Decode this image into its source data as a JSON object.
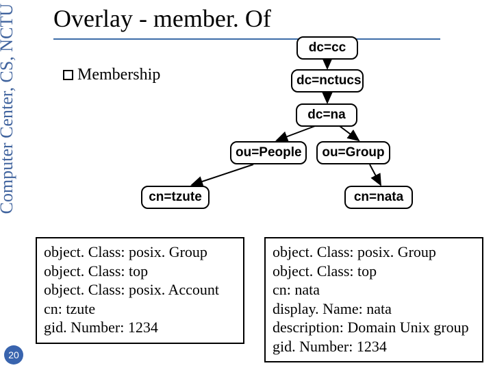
{
  "sidebar": {
    "text": "Computer Center, CS, NCTU"
  },
  "page_number": "20",
  "title": "Overlay - member. Of",
  "bullet": "Membership",
  "nodes": {
    "dc_cc": "dc=cc",
    "dc_nctucs": "dc=nctucs",
    "dc_na": "dc=na",
    "ou_people": "ou=People",
    "ou_group": "ou=Group",
    "cn_tzute": "cn=tzute",
    "cn_nata": "cn=nata"
  },
  "left_box": "object. Class: posix. Group\nobject. Class: top\nobject. Class: posix. Account\ncn: tzute\ngid. Number: 1234",
  "right_box": "object. Class: posix. Group\nobject. Class: top\ncn: nata\ndisplay. Name: nata\ndescription: Domain Unix group\ngid. Number: 1234"
}
